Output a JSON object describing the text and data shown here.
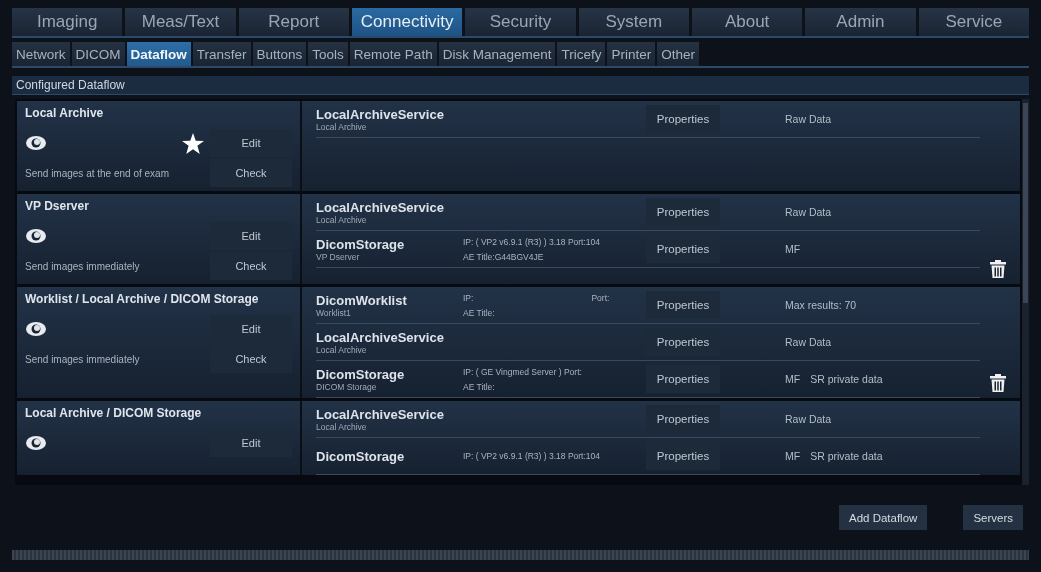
{
  "main_tabs": [
    {
      "label": "Imaging",
      "selected": false
    },
    {
      "label": "Meas/Text",
      "selected": false
    },
    {
      "label": "Report",
      "selected": false
    },
    {
      "label": "Connectivity",
      "selected": true
    },
    {
      "label": "Security",
      "selected": false
    },
    {
      "label": "System",
      "selected": false
    },
    {
      "label": "About",
      "selected": false
    },
    {
      "label": "Admin",
      "selected": false
    },
    {
      "label": "Service",
      "selected": false
    }
  ],
  "sub_tabs": [
    {
      "label": "Network",
      "selected": false
    },
    {
      "label": "DICOM",
      "selected": false
    },
    {
      "label": "Dataflow",
      "selected": true
    },
    {
      "label": "Transfer",
      "selected": false
    },
    {
      "label": "Buttons",
      "selected": false
    },
    {
      "label": "Tools",
      "selected": false
    },
    {
      "label": "Remote Path",
      "selected": false
    },
    {
      "label": "Disk Management",
      "selected": false
    },
    {
      "label": "Tricefy",
      "selected": false
    },
    {
      "label": "Printer",
      "selected": false
    },
    {
      "label": "Other",
      "selected": false
    }
  ],
  "section_title": "Configured Dataflow",
  "dataflows": [
    {
      "name": "Local Archive",
      "default": true,
      "deletable": false,
      "edit": "Edit",
      "check": "Check",
      "description": "Send images at the end of exam",
      "services": [
        {
          "name": "LocalArchiveService",
          "subtitle": "Local Archive",
          "button": "Properties",
          "info": [
            "Raw Data"
          ]
        }
      ]
    },
    {
      "name": "VP Dserver",
      "default": false,
      "deletable": true,
      "edit": "Edit",
      "check": "Check",
      "description": "Send images immediately",
      "services": [
        {
          "name": "LocalArchiveService",
          "subtitle": "Local Archive",
          "button": "Properties",
          "info": [
            "Raw Data"
          ]
        },
        {
          "name": "DicomStorage",
          "subtitle": "VP Dserver",
          "details": [
            [
              "IP: ( VP2 v6.9.1 (R3) ) 3.18 Port:104"
            ],
            [
              "AE Title:G44BGV4JE"
            ]
          ],
          "button": "Properties",
          "info": [
            "MF"
          ]
        }
      ]
    },
    {
      "name": "Worklist / Local Archive / DICOM Storage",
      "default": false,
      "deletable": true,
      "edit": "Edit",
      "check": "Check",
      "description": "Send images immediately",
      "services": [
        {
          "name": "DicomWorklist",
          "subtitle": "Worklist1",
          "details": [
            [
              "IP:",
              "Port:"
            ],
            [
              "AE Title:"
            ]
          ],
          "button": "Properties",
          "info": [
            "Max results: 70"
          ]
        },
        {
          "name": "LocalArchiveService",
          "subtitle": "Local Archive",
          "button": "Properties",
          "info": [
            "Raw Data"
          ]
        },
        {
          "name": "DicomStorage",
          "subtitle": "DICOM Storage",
          "details": [
            [
              "IP: ( GE Vingmed Server ) Port:"
            ],
            [
              "AE Title:"
            ]
          ],
          "button": "Properties",
          "info": [
            "MF",
            "SR private data"
          ]
        }
      ]
    },
    {
      "name": "Local Archive / DICOM Storage",
      "default": false,
      "deletable": false,
      "edit": "Edit",
      "services": [
        {
          "name": "LocalArchiveService",
          "subtitle": "Local Archive",
          "button": "Properties",
          "info": [
            "Raw Data"
          ]
        },
        {
          "name": "DicomStorage",
          "details": [
            [
              "IP: ( VP2 v6.9.1 (R3) ) 3.18 Port:104"
            ]
          ],
          "button": "Properties",
          "info": [
            "MF",
            "SR private data"
          ]
        }
      ]
    }
  ],
  "footer_buttons": [
    "Add Dataflow",
    "Servers"
  ]
}
